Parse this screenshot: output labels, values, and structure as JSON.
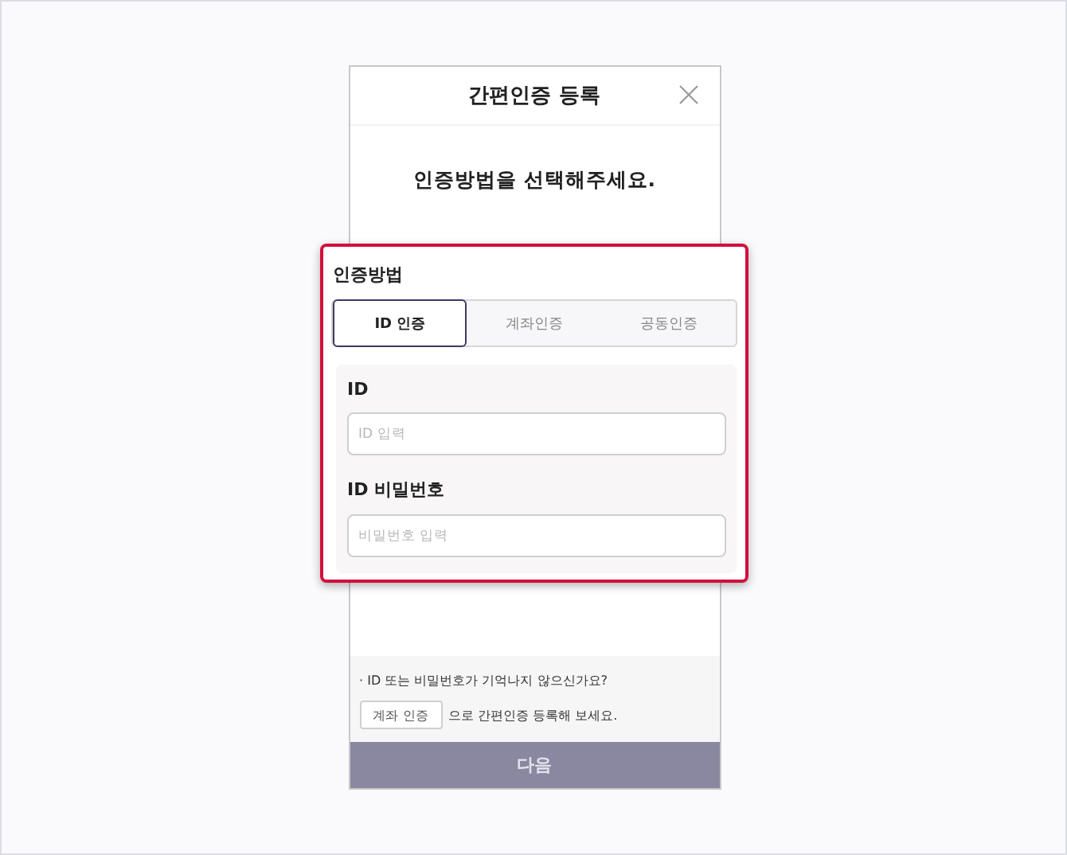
{
  "dialog": {
    "title": "간편인증 등록",
    "subtitle": "인증방법을 선택해주세요."
  },
  "method": {
    "label": "인증방법",
    "tabs": [
      {
        "label": "ID 인증",
        "selected": true
      },
      {
        "label": "계좌인증",
        "selected": false
      },
      {
        "label": "공동인증",
        "selected": false
      }
    ],
    "fields": [
      {
        "label": "ID",
        "placeholder": "ID 입력"
      },
      {
        "label": "ID 비밀번호",
        "placeholder": "비밀번호 입력"
      }
    ]
  },
  "help": {
    "question": "· ID 또는 비밀번호가 기억나지 않으신가요?",
    "button": "계좌 인증",
    "suffix": "으로 간편인증 등록해 보세요."
  },
  "next_button": {
    "label": "다음",
    "disabled": true
  }
}
